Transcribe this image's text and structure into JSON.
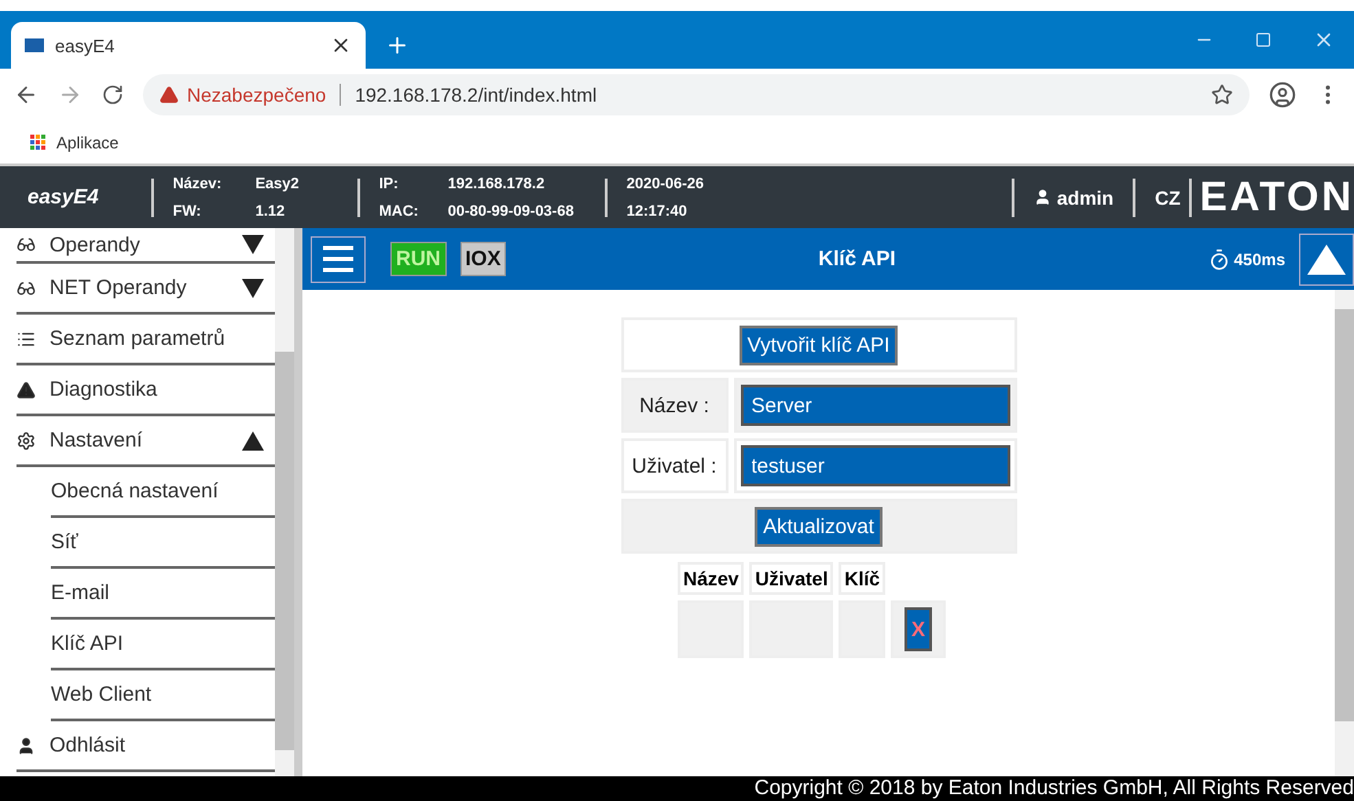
{
  "browser": {
    "tab_title": "easyE4",
    "security": "Nezabezpečeno",
    "url": "192.168.178.2/int/index.html",
    "bookmark": "Aplikace"
  },
  "header": {
    "brand": "easyE4",
    "info": [
      {
        "label": "Název:",
        "value": "Easy2"
      },
      {
        "label": "FW:",
        "value": "1.12"
      },
      {
        "label": "IP:",
        "value": "192.168.178.2"
      },
      {
        "label": "MAC:",
        "value": "00-80-99-09-03-68"
      }
    ],
    "date": "2020-06-26",
    "time": "12:17:40",
    "user": "admin",
    "language": "CZ",
    "logo": "EATON"
  },
  "sidebar": {
    "items": [
      {
        "label": "Operandy",
        "kind": "group",
        "expanded": false
      },
      {
        "label": "NET Operandy",
        "kind": "group",
        "expanded": false
      },
      {
        "label": "Seznam parametrů",
        "kind": "link"
      },
      {
        "label": "Diagnostika",
        "kind": "link"
      },
      {
        "label": "Nastavení",
        "kind": "group",
        "expanded": true,
        "children": [
          {
            "label": "Obecná nastavení",
            "selected": false
          },
          {
            "label": "Síť",
            "selected": false
          },
          {
            "label": "E-mail",
            "selected": false
          },
          {
            "label": "Klíč API",
            "selected": false
          },
          {
            "label": "Web Client",
            "selected": false
          }
        ]
      },
      {
        "label": "Odhlásit",
        "kind": "link"
      }
    ]
  },
  "toolbar": {
    "run": "RUN",
    "iox": "IOX",
    "title": "Klíč API",
    "cycle": "450ms"
  },
  "form": {
    "create_button": "Vytvořit klíč API",
    "fields": [
      {
        "label": "Název :",
        "value": "Server"
      },
      {
        "label": "Uživatel :",
        "value": "testuser"
      }
    ],
    "update_button": "Aktualizovat"
  },
  "table": {
    "columns": [
      "Název",
      "Uživatel",
      "Klíč"
    ],
    "delete_label": "X"
  },
  "footer": "Copyright © 2018 by Eaton Industries GmbH, All Rights Reserved"
}
